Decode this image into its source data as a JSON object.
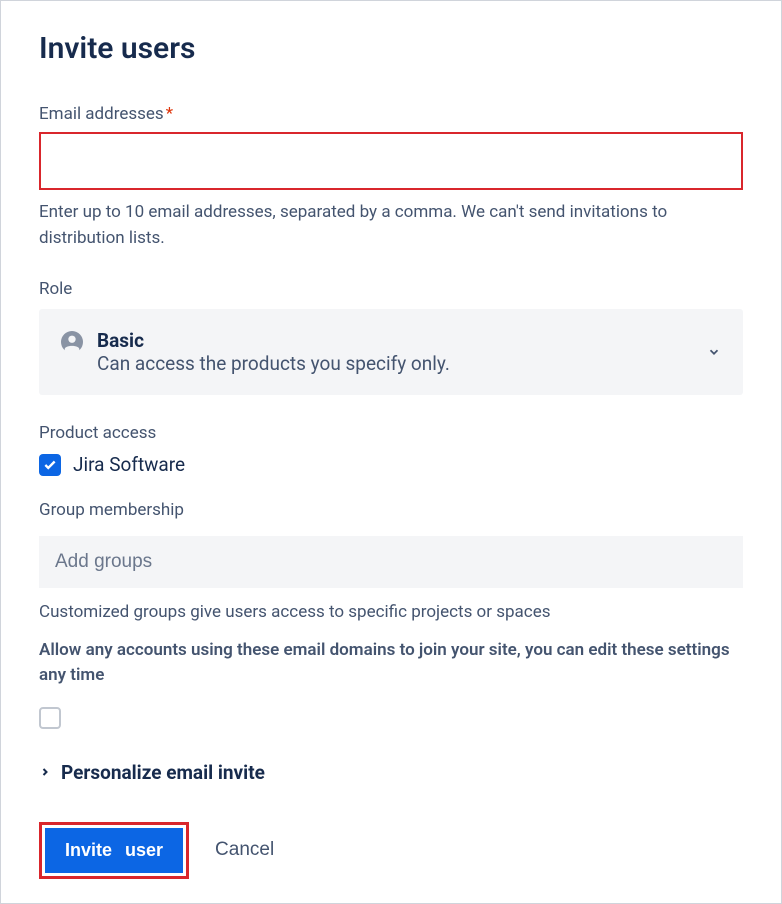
{
  "title": "Invite users",
  "email": {
    "label": "Email addresses",
    "required_marker": "*",
    "value": "",
    "helper": "Enter up to 10 email addresses, separated by a comma. We can't send invitations to distribution lists."
  },
  "role": {
    "label": "Role",
    "selected_title": "Basic",
    "selected_desc": "Can access the products you specify only."
  },
  "product_access": {
    "label": "Product access",
    "items": [
      {
        "label": "Jira Software",
        "checked": true
      }
    ]
  },
  "group_membership": {
    "label": "Group membership",
    "placeholder": "Add groups",
    "helper": "Customized groups give users access to specific projects or spaces"
  },
  "allow_domains": {
    "text": "Allow any accounts using these email domains to join your site, you can edit these settings any time",
    "checked": false
  },
  "personalize": {
    "label": "Personalize email invite"
  },
  "buttons": {
    "invite": "Invite user",
    "cancel": "Cancel"
  }
}
